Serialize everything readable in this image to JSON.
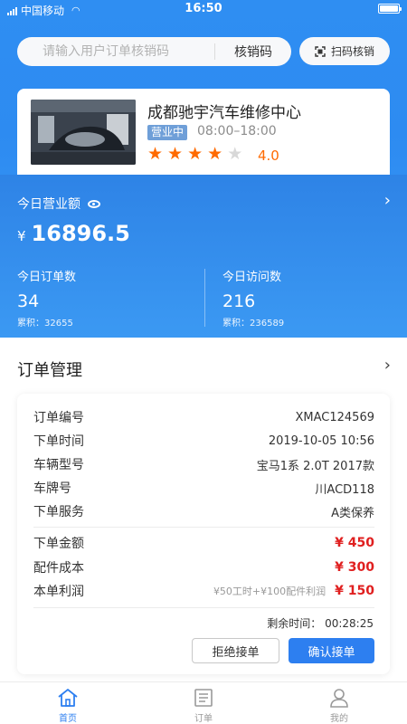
{
  "status_bar": {
    "carrier": "中国移动",
    "time": "16:50"
  },
  "search": {
    "placeholder": "请输入用户订单核销码",
    "verify_label": "核销码",
    "scan_label": "扫码核销"
  },
  "store": {
    "name": "成都驰宇汽车维修中心",
    "status": "营业中",
    "hours": "08:00–18:00",
    "rating": "4.0",
    "stars_filled": 4,
    "stars_total": 5
  },
  "stats": {
    "today_revenue_label": "今日营业额",
    "currency": "¥",
    "today_revenue": "16896.5",
    "orders_label": "今日订单数",
    "orders_value": "34",
    "orders_cumulative": "累积：32655",
    "visits_label": "今日访问数",
    "visits_value": "216",
    "visits_cumulative": "累积：236589"
  },
  "order_mgmt": {
    "title": "订单管理",
    "rows": [
      {
        "key": "订单编号",
        "value": "XMAC124569"
      },
      {
        "key": "下单时间",
        "value": "2019-10-05  10:56"
      },
      {
        "key": "车辆型号",
        "value": "宝马1系 2.0T 2017款"
      },
      {
        "key": "车牌号",
        "value": "川ACD118"
      },
      {
        "key": "下单服务",
        "value": "A类保养"
      }
    ],
    "money_rows": [
      {
        "key": "下单金额",
        "value": "¥ 450",
        "note": ""
      },
      {
        "key": "配件成本",
        "value": "¥ 300",
        "note": ""
      },
      {
        "key": "本单利润",
        "value": "¥ 150",
        "note": "¥50工时+¥100配件利润"
      }
    ],
    "remaining": "剩余时间： 00:28:25",
    "reject_label": "拒绝接单",
    "accept_label": "确认接单"
  },
  "tabs": [
    {
      "label": "首页",
      "icon": "home-icon",
      "active": true
    },
    {
      "label": "订单",
      "icon": "document-icon",
      "active": false
    },
    {
      "label": "我的",
      "icon": "user-icon",
      "active": false
    }
  ],
  "colors": {
    "brand_blue": "#2d7ff0",
    "star_orange": "#ff6a00",
    "price_red": "#e02020"
  }
}
